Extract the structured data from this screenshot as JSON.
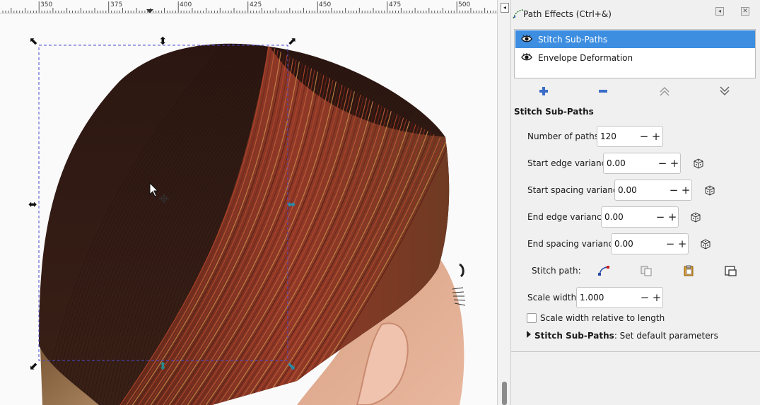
{
  "ruler": {
    "labels": [
      "350",
      "375",
      "400",
      "425",
      "450",
      "475",
      "500"
    ]
  },
  "panel": {
    "title": "Path Effects (Ctrl+&)",
    "effects": [
      {
        "label": "Stitch Sub-Paths",
        "selected": true
      },
      {
        "label": "Envelope Deformation",
        "selected": false
      }
    ],
    "tool_icons": [
      "add-effect-icon",
      "remove-effect-icon",
      "move-up-icon",
      "move-down-icon"
    ],
    "section_title": "Stitch Sub-Paths",
    "params": {
      "num_paths": {
        "label": "Number of paths:",
        "value": "120"
      },
      "start_edge": {
        "label": "Start edge variance:",
        "value": "0.00"
      },
      "start_spacing": {
        "label": "Start spacing variance:",
        "value": "0.00"
      },
      "end_edge": {
        "label": "End edge variance:",
        "value": "0.00"
      },
      "end_spacing": {
        "label": "End spacing variance:",
        "value": "0.00"
      },
      "stitch_path": {
        "label": "Stitch path:"
      },
      "scale_width": {
        "label": "Scale width:",
        "value": "1.000"
      }
    },
    "scale_relative": {
      "label": "Scale width relative to length",
      "checked": false
    },
    "expander": {
      "bold": "Stitch Sub-Paths",
      "rest": ": Set default parameters"
    },
    "colors": {
      "selection": "#3d8ee0",
      "hair_dark": "#2a1510",
      "hair_red": "#8a2e22"
    }
  }
}
